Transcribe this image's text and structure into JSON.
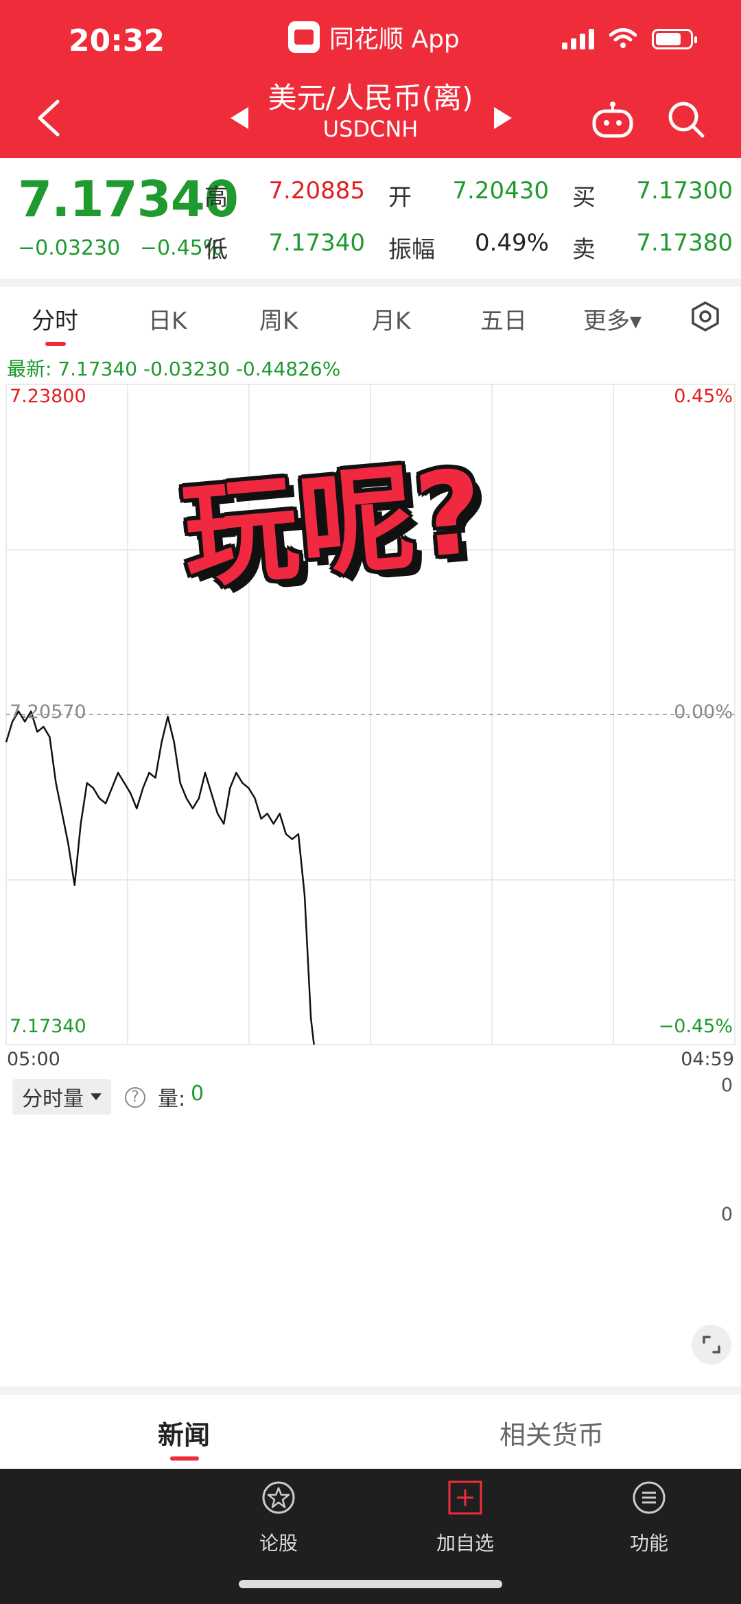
{
  "status": {
    "time": "20:32",
    "app_name": "同花顺 App"
  },
  "header": {
    "title": "美元/人民币(离)",
    "code": "USDCNH"
  },
  "quote": {
    "price": "7.17340",
    "change": "−0.03230",
    "change_pct": "−0.45%",
    "high_label": "高",
    "high": "7.20885",
    "low_label": "低",
    "low": "7.17340",
    "open_label": "开",
    "open": "7.20430",
    "amplitude_label": "振幅",
    "amplitude": "0.49%",
    "bid_label": "买",
    "bid": "7.17300",
    "ask_label": "卖",
    "ask": "7.17380"
  },
  "tabs": [
    "分时",
    "日K",
    "周K",
    "月K",
    "五日",
    "更多▾"
  ],
  "latest_line": "最新: 7.17340   -0.03230   -0.44826%",
  "chart_data": {
    "type": "line",
    "y_top_label": "7.23800",
    "y_bottom_label": "7.17340",
    "y_mid_label": "7.20570",
    "right_top_label": "0.45%",
    "right_mid_label": "0.00%",
    "right_bottom_label": "−0.45%",
    "x_start": "05:00",
    "x_end": "04:59",
    "ylim": [
      7.1734,
      7.238
    ],
    "x": [
      0,
      4,
      8,
      12,
      16,
      20,
      24,
      28,
      32,
      36,
      40,
      44,
      48,
      52,
      56,
      60,
      64,
      68,
      72,
      76,
      80,
      84,
      88,
      92,
      96,
      100,
      104,
      108,
      112,
      116,
      120,
      124,
      128,
      132,
      136,
      140,
      144,
      148,
      152,
      156,
      160,
      164,
      168,
      172,
      176,
      180,
      184,
      188,
      192,
      196,
      198
    ],
    "values": [
      7.203,
      7.205,
      7.206,
      7.205,
      7.206,
      7.204,
      7.2045,
      7.2035,
      7.199,
      7.196,
      7.193,
      7.189,
      7.195,
      7.199,
      7.1985,
      7.1975,
      7.197,
      7.1985,
      7.2,
      7.199,
      7.198,
      7.1965,
      7.1985,
      7.2,
      7.1995,
      7.203,
      7.2055,
      7.203,
      7.199,
      7.1975,
      7.1965,
      7.1975,
      7.2,
      7.198,
      7.196,
      7.195,
      7.1985,
      7.2,
      7.199,
      7.1985,
      7.1975,
      7.1955,
      7.196,
      7.195,
      7.196,
      7.194,
      7.1935,
      7.194,
      7.188,
      7.176,
      7.1734
    ]
  },
  "overlay_text": "玩呢?",
  "volume": {
    "dropdown_label": "分时量",
    "label": "量:",
    "value": "0",
    "axis_top": "0",
    "axis_mid": "0"
  },
  "news_tabs": [
    "新闻",
    "相关货币"
  ],
  "bottom_nav": [
    {
      "label": "论股"
    },
    {
      "label": "加自选"
    },
    {
      "label": "功能"
    }
  ],
  "colors": {
    "brand_red": "#ef2c3a",
    "up_red": "#e02020",
    "down_green": "#1e9a2e"
  }
}
